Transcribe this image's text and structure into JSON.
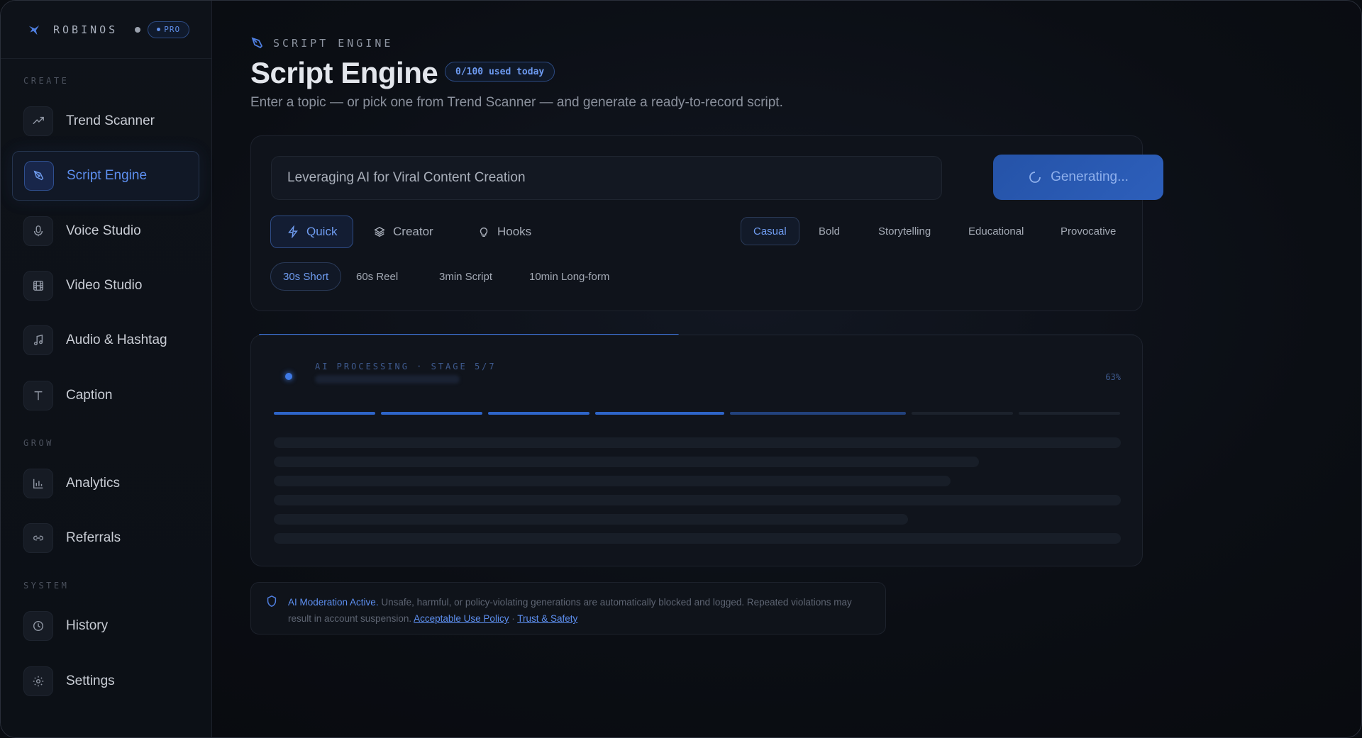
{
  "brand": {
    "name": "ROBINOS",
    "badge": "PRO"
  },
  "sidebar": {
    "sections": [
      "CREATE",
      "GROW",
      "SYSTEM"
    ],
    "items": [
      {
        "label": "Trend Scanner",
        "icon": "trend-icon"
      },
      {
        "label": "Script Engine",
        "icon": "pen-icon",
        "active": true
      },
      {
        "label": "Voice Studio",
        "icon": "mic-icon"
      },
      {
        "label": "Video Studio",
        "icon": "film-icon"
      },
      {
        "label": "Audio & Hashtag",
        "icon": "music-icon"
      },
      {
        "label": "Caption",
        "icon": "text-icon"
      },
      {
        "label": "Analytics",
        "icon": "bar-chart-icon"
      },
      {
        "label": "Referrals",
        "icon": "link-icon"
      },
      {
        "label": "History",
        "icon": "clock-icon"
      },
      {
        "label": "Settings",
        "icon": "gear-icon"
      }
    ]
  },
  "header": {
    "eyebrow": "SCRIPT ENGINE",
    "title": "Script Engine",
    "usage": "0/100 used today",
    "subtitle": "Enter a topic — or pick one from Trend Scanner — and generate a ready-to-record script."
  },
  "composer": {
    "topic_value": "Leveraging AI for Viral Content Creation",
    "generate_label": "Generating...",
    "modes": [
      {
        "label": "Quick",
        "icon": "bolt-icon",
        "active": true
      },
      {
        "label": "Creator",
        "icon": "layers-icon"
      },
      {
        "label": "Hooks",
        "icon": "bulb-icon"
      }
    ],
    "tones": [
      {
        "label": "Casual",
        "active": true
      },
      {
        "label": "Bold"
      },
      {
        "label": "Storytelling"
      },
      {
        "label": "Educational"
      },
      {
        "label": "Provocative"
      }
    ],
    "lengths": [
      {
        "label": "30s Short",
        "active": true
      },
      {
        "label": "60s Reel"
      },
      {
        "label": "3min Script"
      },
      {
        "label": "10min Long-form"
      }
    ]
  },
  "processing": {
    "label": "AI PROCESSING · STAGE 5/7",
    "percent": "63%",
    "progress": 0.48,
    "stages_total": 7,
    "stages_done": 4,
    "stage_current": 5
  },
  "moderation": {
    "lead": "AI Moderation Active.",
    "text": "Unsafe, harmful, or policy-violating generations are automatically blocked and logged. Repeated violations may result in account suspension.",
    "link1": "Acceptable Use Policy",
    "sep": "·",
    "link2": "Trust & Safety"
  },
  "colors": {
    "accent": "#3b73dc",
    "accent_text": "#5d8ff0",
    "background": "#0a0d12"
  }
}
